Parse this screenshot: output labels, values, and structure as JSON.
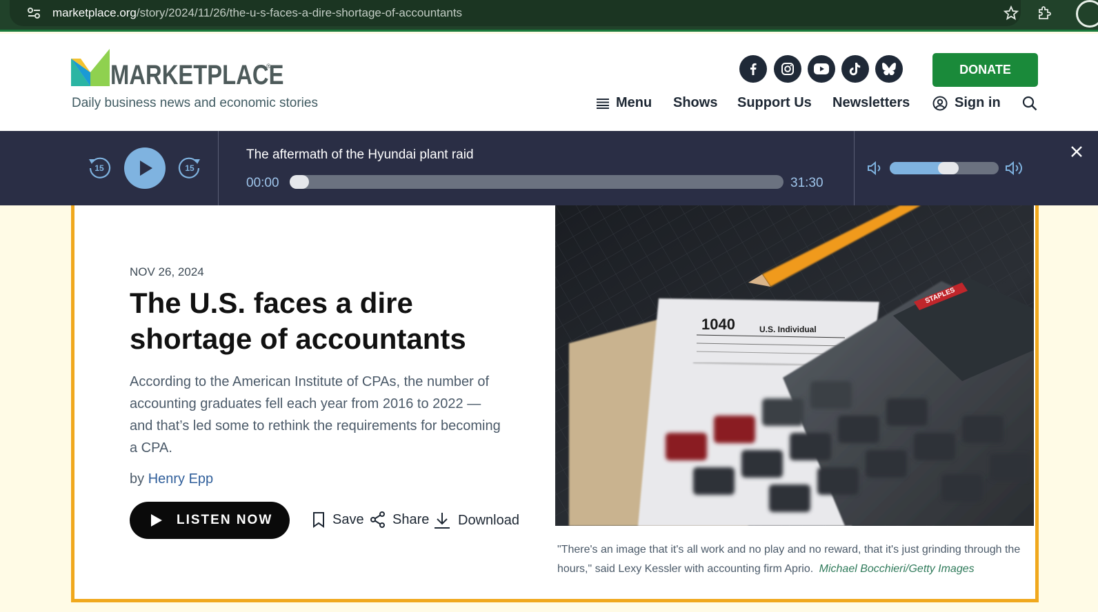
{
  "browser": {
    "url_host": "marketplace.org",
    "url_path": "/story/2024/11/26/the-u-s-faces-a-dire-shortage-of-accountants"
  },
  "header": {
    "logo_text": "MARKETPLACE",
    "logo_reg": "®",
    "tagline": "Daily business news and economic stories",
    "social": [
      "facebook-icon",
      "instagram-icon",
      "youtube-icon",
      "tiktok-icon",
      "bluesky-icon"
    ],
    "donate_label": "DONATE",
    "nav": {
      "menu": "Menu",
      "shows": "Shows",
      "support": "Support Us",
      "newsletters": "Newsletters",
      "signin": "Sign in"
    },
    "colors": {
      "donate": "#1a8a3a",
      "text": "#1d2733"
    }
  },
  "player": {
    "rewind_label": "15",
    "forward_label": "15",
    "track_title": "The aftermath of the Hyundai plant raid",
    "current_time": "00:00",
    "duration": "31:30",
    "progress": 0,
    "volume": 0.55,
    "colors": {
      "background": "#2a2e45",
      "accent": "#7fb3e0"
    }
  },
  "article": {
    "date": "NOV 26, 2024",
    "headline": "The U.S. faces a dire shortage of accountants",
    "dek": "According to the American Institute of CPAs, the number of accounting graduates fell each year from 2016 to 2022 — and that’s led some to rethink the requirements for becoming a CPA.",
    "byline_prefix": "by",
    "author": "Henry Epp",
    "listen_label": "LISTEN NOW",
    "actions": {
      "save": "Save",
      "share": "Share",
      "download": "Download"
    },
    "photo_form_number": "1040",
    "photo_form_title": "U.S. Individual",
    "photo_brand": "STAPLES",
    "caption": "\"There's an image that it's all work and no play and no reward, that it's just grinding through the hours,\" said Lexy Kessler with accounting firm Aprio.",
    "credit": "Michael Bocchieri/Getty Images",
    "colors": {
      "border": "#f0a81d",
      "author": "#2f5e9a"
    }
  }
}
